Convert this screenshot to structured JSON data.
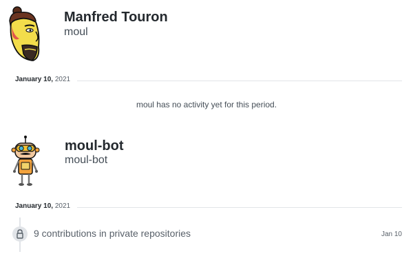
{
  "profiles": [
    {
      "name": "Manfred Touron",
      "login": "moul",
      "avatar": "manfred-cartoon-avatar",
      "date_heading": {
        "day": "January 10,",
        "year": "2021"
      },
      "empty_message": "moul has no activity yet for this period."
    },
    {
      "name": "moul-bot",
      "login": "moul-bot",
      "avatar": "robot-cartoon-avatar",
      "date_heading": {
        "day": "January 10,",
        "year": "2021"
      },
      "activity": {
        "icon": "lock-icon",
        "text": "9 contributions in private repositories",
        "date": "Jan 10"
      }
    }
  ],
  "colors": {
    "text_primary": "#24292e",
    "text_secondary": "#586069",
    "divider": "#e1e4e8"
  }
}
